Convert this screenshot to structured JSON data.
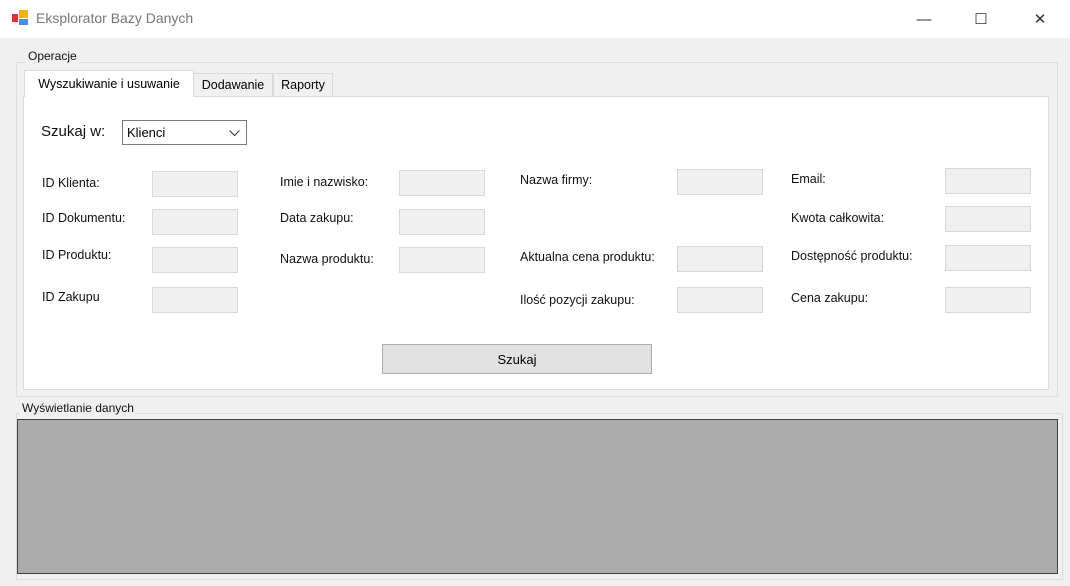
{
  "window": {
    "title": "Eksplorator Bazy Danych",
    "minimize": "—",
    "maximize": "☐",
    "close": "✕"
  },
  "operations": {
    "group_label": "Operacje",
    "tabs": [
      "Wyszukiwanie i usuwanie",
      "Dodawanie",
      "Raporty"
    ],
    "search_in_label": "Szukaj w:",
    "search_in_value": "Klienci",
    "fields": [
      "ID Klienta:",
      "ID Dokumentu:",
      "ID Produktu:",
      "ID Zakupu",
      "Imie i nazwisko:",
      "Data zakupu:",
      "Nazwa produktu:",
      "Nazwa firmy:",
      "Aktualna cena produktu:",
      "Ilość pozycji zakupu:",
      "Email:",
      "Kwota całkowita:",
      "Dostępność produktu:",
      "Cena zakupu:"
    ],
    "search_button": "Szukaj"
  },
  "display": {
    "group_label": "Wyświetlanie danych"
  }
}
